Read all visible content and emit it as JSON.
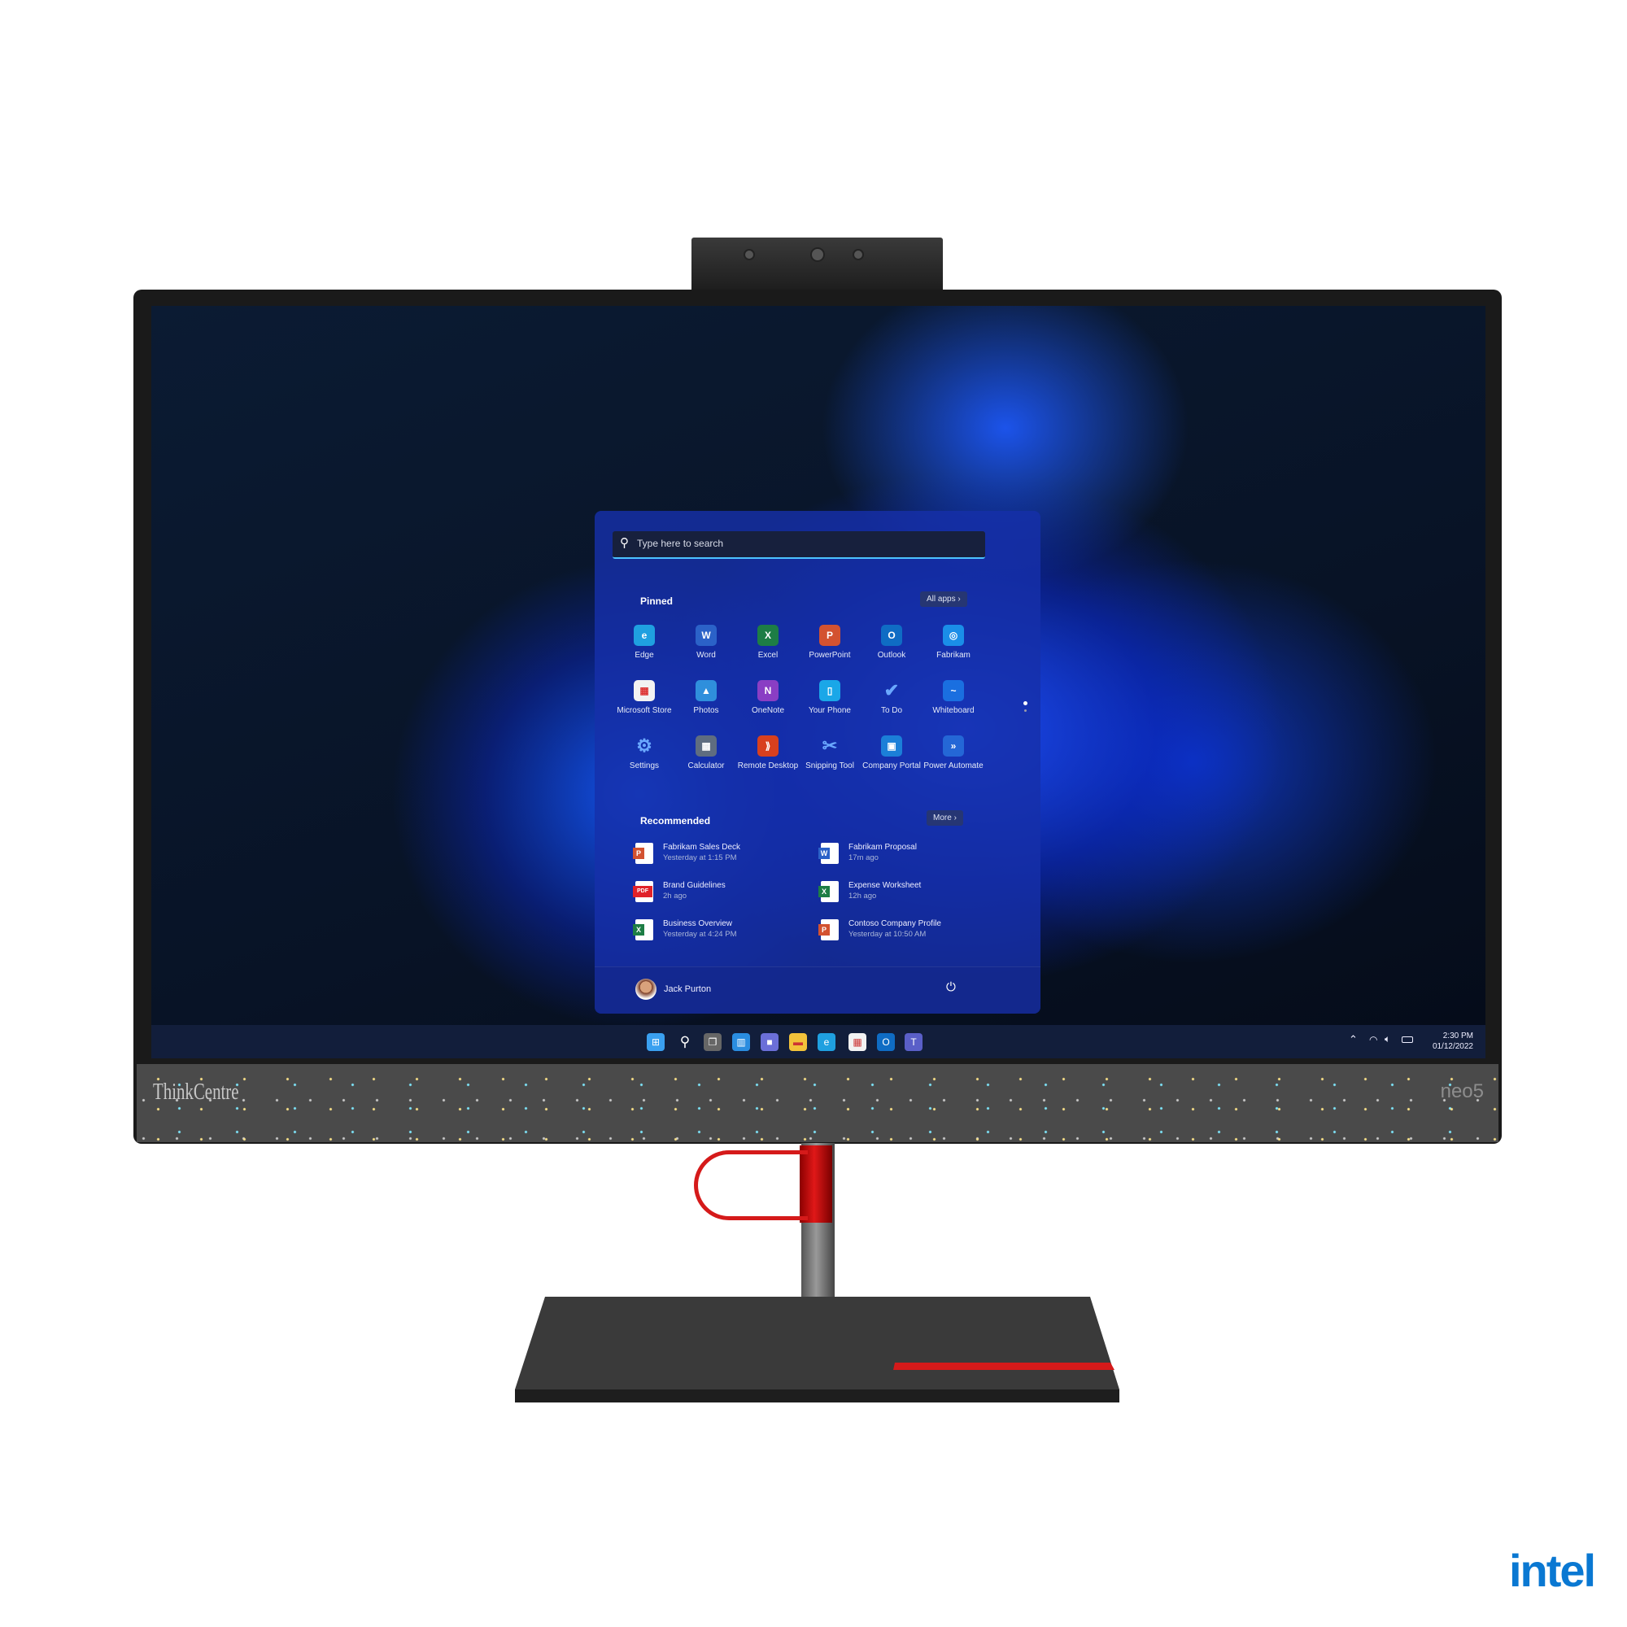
{
  "brand": {
    "bezel_logo": "ThinkCentre",
    "model_logo": "neo5",
    "intel_logo": "intel"
  },
  "start_menu": {
    "search_placeholder": "Type here to search",
    "pinned_label": "Pinned",
    "all_apps_label": "All apps",
    "pinned": [
      {
        "label": "Edge",
        "icon": "edge-icon",
        "color": "#1fa0e0",
        "glyph": "e"
      },
      {
        "label": "Word",
        "icon": "word-icon",
        "color": "#2b62c8",
        "glyph": "W"
      },
      {
        "label": "Excel",
        "icon": "excel-icon",
        "color": "#1d7d45",
        "glyph": "X"
      },
      {
        "label": "PowerPoint",
        "icon": "powerpoint-icon",
        "color": "#d35230",
        "glyph": "P"
      },
      {
        "label": "Outlook",
        "icon": "outlook-icon",
        "color": "#0f6cc4",
        "glyph": "O"
      },
      {
        "label": "Fabrikam",
        "icon": "fabrikam-icon",
        "color": "#1a8ee8",
        "glyph": "◎"
      },
      {
        "label": "Microsoft Store",
        "icon": "store-icon",
        "color": "#f2f2f2",
        "glyph": "▦"
      },
      {
        "label": "Photos",
        "icon": "photos-icon",
        "color": "#2f8fdc",
        "glyph": "▲"
      },
      {
        "label": "OneNote",
        "icon": "onenote-icon",
        "color": "#8a3ec4",
        "glyph": "N"
      },
      {
        "label": "Your Phone",
        "icon": "phone-icon",
        "color": "#1aa7e8",
        "glyph": "▯"
      },
      {
        "label": "To Do",
        "icon": "todo-icon",
        "color": "transparent",
        "glyph": "✔"
      },
      {
        "label": "Whiteboard",
        "icon": "whiteboard-icon",
        "color": "#1a6fe0",
        "glyph": "~"
      },
      {
        "label": "Settings",
        "icon": "settings-icon",
        "color": "transparent",
        "glyph": "⚙"
      },
      {
        "label": "Calculator",
        "icon": "calculator-icon",
        "color": "#5f6d80",
        "glyph": "▦"
      },
      {
        "label": "Remote Desktop",
        "icon": "remote-desktop-icon",
        "color": "#d8401e",
        "glyph": "⟫"
      },
      {
        "label": "Snipping Tool",
        "icon": "snipping-tool-icon",
        "color": "transparent",
        "glyph": "✂"
      },
      {
        "label": "Company Portal",
        "icon": "company-portal-icon",
        "color": "#1b7fd8",
        "glyph": "▣"
      },
      {
        "label": "Power Automate",
        "icon": "power-automate-icon",
        "color": "#2467d6",
        "glyph": "»"
      }
    ],
    "recommended_label": "Recommended",
    "more_label": "More",
    "recommended": [
      {
        "title": "Fabrikam Sales Deck",
        "time": "Yesterday at 1:15 PM",
        "icon": "powerpoint-file-icon",
        "color": "#d35230",
        "glyph": "P"
      },
      {
        "title": "Fabrikam Proposal",
        "time": "17m ago",
        "icon": "word-file-icon",
        "color": "#2b62c8",
        "glyph": "W"
      },
      {
        "title": "Brand Guidelines",
        "time": "2h ago",
        "icon": "pdf-file-icon",
        "color": "#e0222a",
        "glyph": "PDF"
      },
      {
        "title": "Expense Worksheet",
        "time": "12h ago",
        "icon": "excel-file-icon",
        "color": "#1d7d45",
        "glyph": "X"
      },
      {
        "title": "Business Overview",
        "time": "Yesterday at 4:24 PM",
        "icon": "excel-file-icon",
        "color": "#1d7d45",
        "glyph": "X"
      },
      {
        "title": "Contoso Company Profile",
        "time": "Yesterday at 10:50 AM",
        "icon": "powerpoint-file-icon",
        "color": "#d35230",
        "glyph": "P"
      }
    ],
    "user_name": "Jack Purton"
  },
  "taskbar": {
    "icons": [
      {
        "name": "start-icon",
        "color": "#3aa0f0",
        "glyph": "⊞"
      },
      {
        "name": "search-icon",
        "color": "transparent",
        "glyph": "⚲"
      },
      {
        "name": "task-view-icon",
        "color": "#666",
        "glyph": "❐"
      },
      {
        "name": "widgets-icon",
        "color": "#2a8de0",
        "glyph": "▥"
      },
      {
        "name": "chat-icon",
        "color": "#6b6fd8",
        "glyph": "■"
      },
      {
        "name": "file-explorer-icon",
        "color": "#f2c23a",
        "glyph": "▬"
      },
      {
        "name": "edge-icon",
        "color": "#1fa0e0",
        "glyph": "e"
      },
      {
        "name": "store-icon",
        "color": "#f2f2f2",
        "glyph": "▦"
      },
      {
        "name": "outlook-icon",
        "color": "#0f6cc4",
        "glyph": "O"
      },
      {
        "name": "teams-icon",
        "color": "#5a5fc8",
        "glyph": "T"
      }
    ],
    "time": "2:30 PM",
    "date": "01/12/2022"
  }
}
